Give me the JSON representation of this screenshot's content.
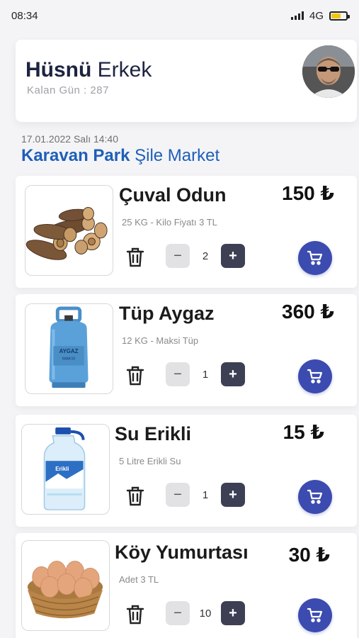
{
  "status_bar": {
    "time": "08:34",
    "network": "4G",
    "battery_color": "#f3c613"
  },
  "profile": {
    "first_name": "Hüsnü",
    "last_name": "Erkek",
    "days_left": "Kalan Gün : 287"
  },
  "location": {
    "date": "17.01.2022 Salı 14:40",
    "park": "Karavan Park",
    "market": "Şile Market"
  },
  "colors": {
    "accent": "#1e5fb8",
    "cart": "#3c4bb0",
    "plus": "#3d3f54"
  },
  "products": [
    {
      "name": "Çuval Odun",
      "price": "150 ₺",
      "description": "25 KG - Kilo Fiyatı  3 TL",
      "quantity": "2",
      "image": "firewood-image"
    },
    {
      "name": "Tüp Aygaz",
      "price": "360 ₺",
      "description": "12 KG - Maksi Tüp",
      "quantity": "1",
      "image": "gas-cylinder-image"
    },
    {
      "name": "Su Erikli",
      "price": "15 ₺",
      "description": "5 Litre Erikli Su",
      "quantity": "1",
      "image": "water-bottle-image"
    },
    {
      "name": "Köy Yumurtası",
      "price": "30 ₺",
      "description": "Adet 3 TL",
      "quantity": "10",
      "image": "eggs-basket-image"
    }
  ],
  "controls": {
    "minus": "−",
    "plus": "+"
  }
}
